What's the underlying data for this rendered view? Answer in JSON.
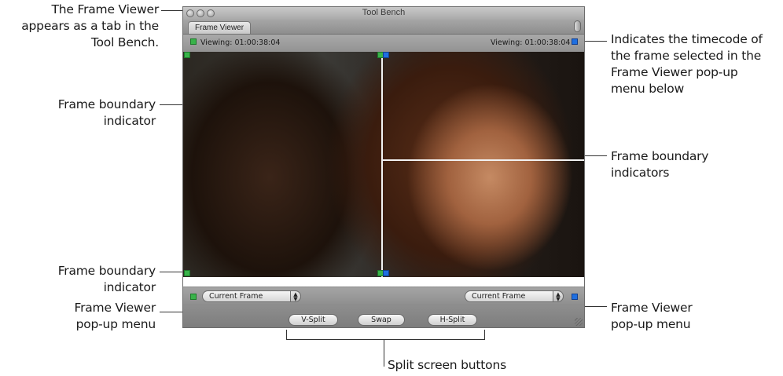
{
  "window": {
    "title": "Tool Bench",
    "tab_label": "Frame Viewer"
  },
  "viewer": {
    "left_timecode": "Viewing: 01:00:38:04",
    "right_timecode": "Viewing: 01:00:38:04",
    "left_popup_value": "Current Frame",
    "right_popup_value": "Current Frame"
  },
  "buttons": {
    "vsplit": "V-Split",
    "swap": "Swap",
    "hsplit": "H-Split"
  },
  "callouts": {
    "frame_viewer_tab_1": "The Frame Viewer",
    "frame_viewer_tab_2": "appears as a tab in the",
    "frame_viewer_tab_3": "Tool Bench.",
    "boundary_top_1": "Frame boundary",
    "boundary_top_2": "indicator",
    "boundary_bottom_1": "Frame boundary",
    "boundary_bottom_2": "indicator",
    "popup_left_1": "Frame Viewer",
    "popup_left_2": "pop-up menu",
    "timecode_1": "Indicates the timecode of",
    "timecode_2": "the frame selected in the",
    "timecode_3": "Frame Viewer pop-up",
    "timecode_4": "menu below",
    "boundaries_1": "Frame boundary",
    "boundaries_2": "indicators",
    "popup_right_1": "Frame Viewer",
    "popup_right_2": "pop-up menu",
    "split_buttons": "Split screen buttons"
  },
  "colors": {
    "boundary_green": "#39b34a",
    "boundary_blue": "#1f6fe0"
  }
}
